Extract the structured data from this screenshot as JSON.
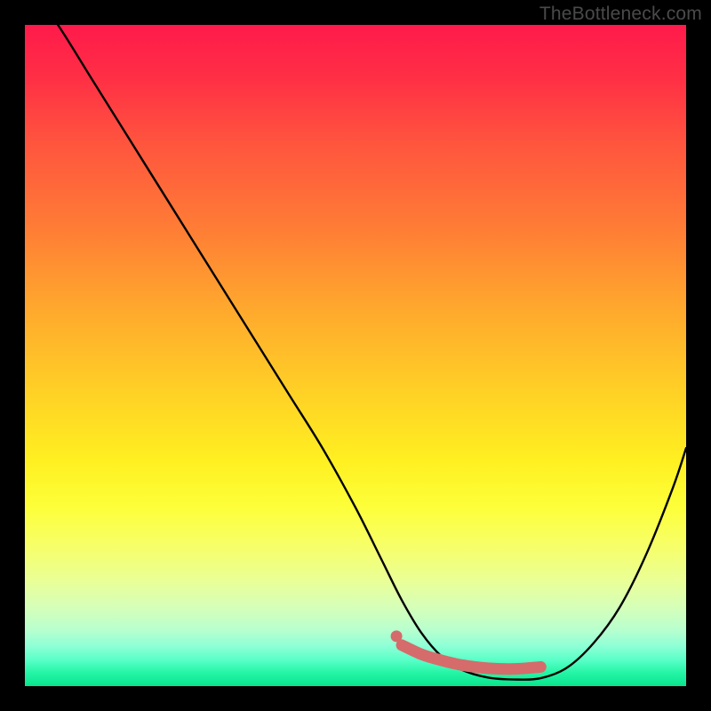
{
  "watermark": "TheBottleneck.com",
  "colors": {
    "frame": "#000000",
    "curve": "#000000",
    "marker_fill": "#d66b6b",
    "marker_stroke": "#c85e5e"
  },
  "chart_data": {
    "type": "line",
    "title": "",
    "xlabel": "",
    "ylabel": "",
    "xlim": [
      0,
      100
    ],
    "ylim": [
      0,
      100
    ],
    "grid": false,
    "legend": false,
    "series": [
      {
        "name": "bottleneck-curve",
        "x": [
          0,
          5,
          10,
          15,
          20,
          25,
          30,
          35,
          40,
          45,
          50,
          54,
          57,
          60,
          63,
          66,
          70,
          74,
          78,
          82,
          86,
          90,
          94,
          98,
          100
        ],
        "y": [
          107,
          100,
          92,
          84,
          76,
          68,
          60,
          52,
          44,
          36,
          27,
          19,
          13,
          8,
          4.5,
          2.5,
          1.3,
          1.0,
          1.2,
          2.8,
          6.5,
          12,
          20,
          30,
          36
        ]
      }
    ],
    "markers": {
      "name": "optimal-range",
      "x": [
        57,
        60,
        63,
        66,
        70,
        74,
        78
      ],
      "y": [
        6.2,
        4.8,
        3.9,
        3.2,
        2.7,
        2.6,
        2.9
      ]
    }
  }
}
